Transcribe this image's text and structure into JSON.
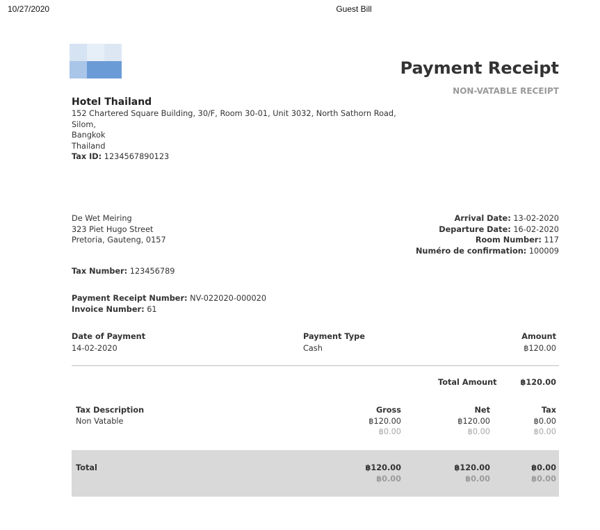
{
  "print_header": {
    "date": "10/27/2020",
    "title": "Guest Bill"
  },
  "document": {
    "title": "Payment Receipt",
    "subtitle": "NON-VATABLE RECEIPT"
  },
  "company": {
    "name": "Hotel Thailand",
    "address_line1": "152 Chartered Square Building, 30/F, Room 30-01, Unit 3032, North Sathorn Road, Silom,",
    "address_line2": "Bangkok",
    "country": "Thailand",
    "tax_id_label": "Tax ID:",
    "tax_id": "1234567890123"
  },
  "guest": {
    "name": "De Wet Meiring",
    "street": "323 Piet Hugo Street",
    "city": "Pretoria, Gauteng, 0157"
  },
  "stay": {
    "arrival_label": "Arrival Date:",
    "arrival": "13-02-2020",
    "departure_label": "Departure Date:",
    "departure": "16-02-2020",
    "room_label": "Room Number:",
    "room": "117",
    "confirmation_label": "Numéro de confirmation:",
    "confirmation": "100009"
  },
  "tax_number": {
    "label": "Tax Number:",
    "value": "123456789"
  },
  "receipt": {
    "number_label": "Payment Receipt Number:",
    "number": "NV-022020-000020",
    "invoice_label": "Invoice Number:",
    "invoice": "61"
  },
  "payments": {
    "headers": {
      "date": "Date of Payment",
      "type": "Payment Type",
      "amount": "Amount"
    },
    "rows": [
      {
        "date": "14-02-2020",
        "type": "Cash",
        "amount": "฿120.00"
      }
    ],
    "total_label": "Total Amount",
    "total": "฿120.00"
  },
  "tax_table": {
    "headers": {
      "description": "Tax Description",
      "gross": "Gross",
      "net": "Net",
      "tax": "Tax"
    },
    "rows": [
      {
        "description": "Non Vatable",
        "gross": "฿120.00",
        "gross_secondary": "฿0.00",
        "net": "฿120.00",
        "net_secondary": "฿0.00",
        "tax": "฿0.00",
        "tax_secondary": "฿0.00"
      }
    ],
    "total": {
      "label": "Total",
      "gross": "฿120.00",
      "gross_secondary": "฿0.00",
      "net": "฿120.00",
      "net_secondary": "฿0.00",
      "tax": "฿0.00",
      "tax_secondary": "฿0.00"
    }
  },
  "colors": {
    "logo_light": "#dde7f4",
    "logo_mid": "#a9c5e8",
    "logo_dark": "#6a9bd6",
    "total_row_bg": "#d9d9d9",
    "muted_text": "#a8a8a8"
  }
}
